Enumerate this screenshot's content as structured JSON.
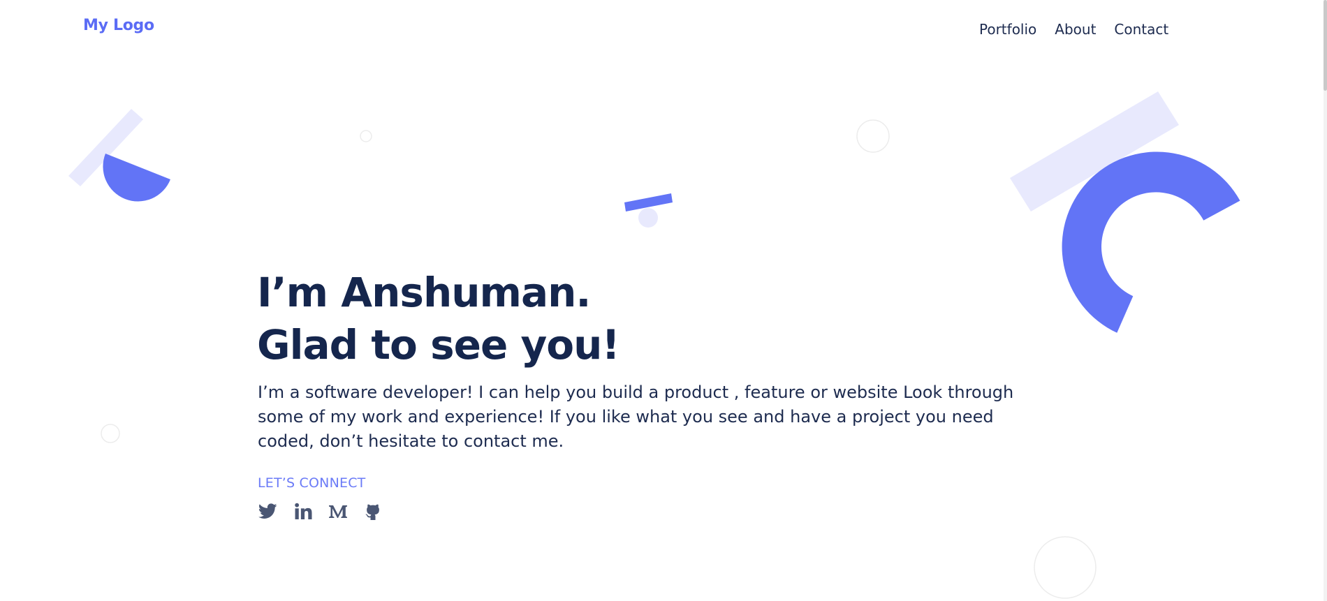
{
  "header": {
    "logo": "My Logo",
    "nav": [
      "Portfolio",
      "About",
      "Contact"
    ]
  },
  "hero": {
    "title_line1": "I’m Anshuman.",
    "title_line2": "Glad to see you!",
    "description": "I’m a software developer! I can help you build a product , feature or website Look through some of my work and experience! If you like what you see and have a project you need coded, don’t hesitate to contact me.",
    "connect_label": "LET’S CONNECT",
    "socials": [
      "twitter-icon",
      "linkedin-icon",
      "medium-icon",
      "github-icon"
    ]
  },
  "colors": {
    "accent": "#6274f6",
    "accent_light": "#e8e9fd",
    "text_dark": "#15264d",
    "ring": "#eeeeee"
  }
}
